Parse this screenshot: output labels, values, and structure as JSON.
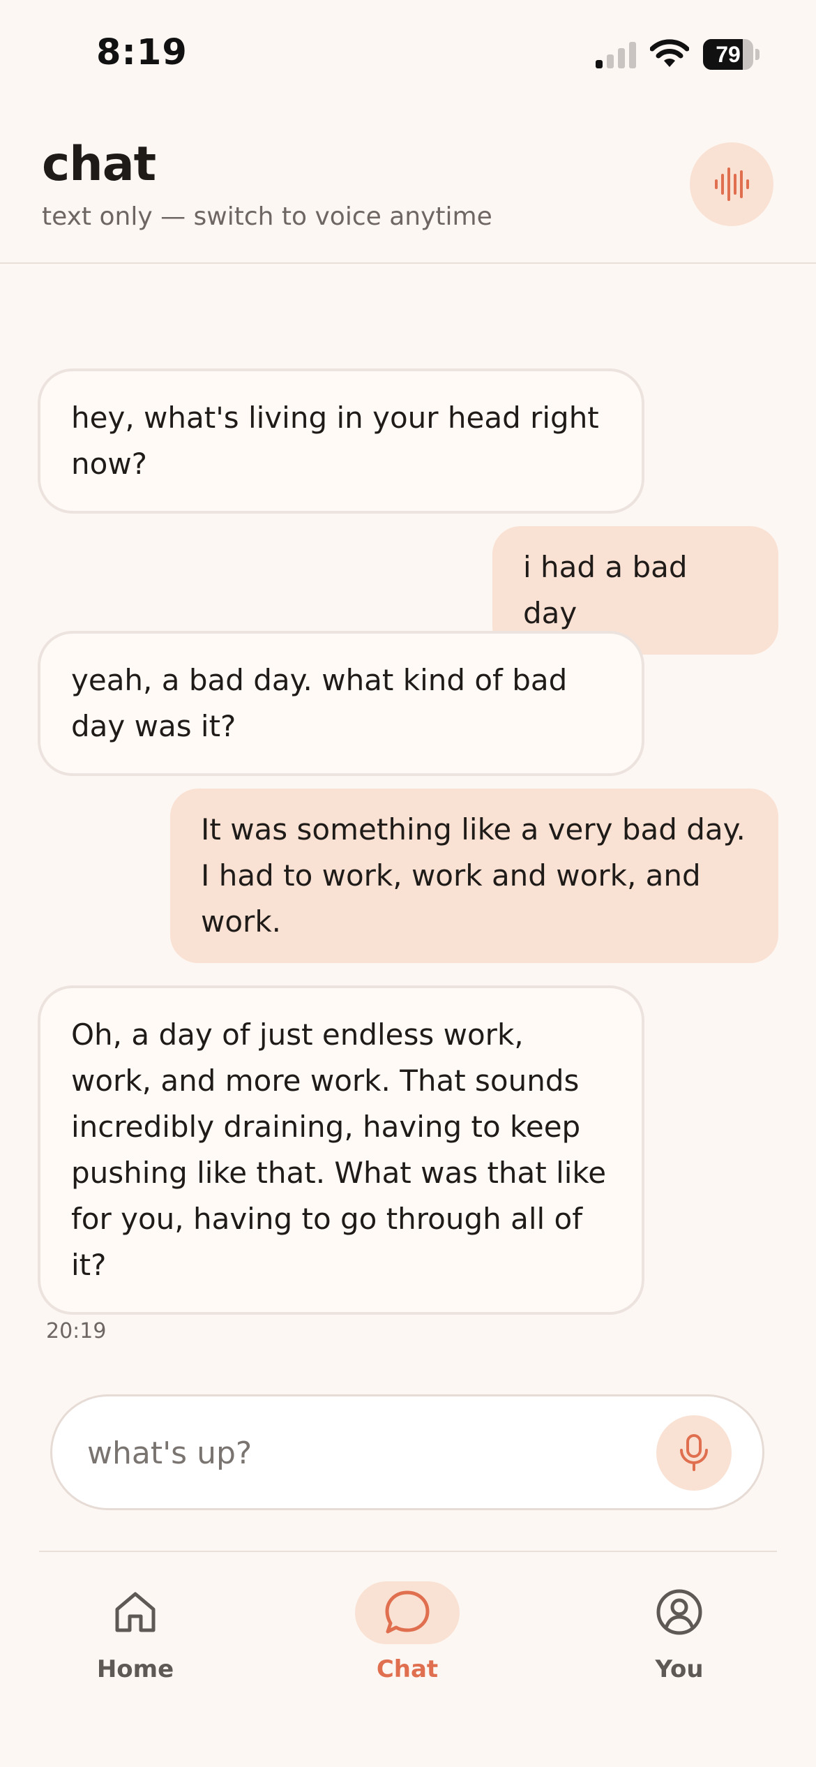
{
  "status_bar": {
    "time": "8:19",
    "battery": "79",
    "battery_level": 0.79,
    "signal_bars_active": 1,
    "signal_bars_total": 4
  },
  "header": {
    "title": "chat",
    "subtitle": "text only — switch to voice anytime",
    "voice_icon": "voice-waveform-icon"
  },
  "messages": [
    {
      "sender": "bot",
      "text": "hey, what's living in your head right now?"
    },
    {
      "sender": "user",
      "text": "i had a bad day"
    },
    {
      "sender": "bot",
      "text": "yeah, a bad day. what kind of bad day was it?"
    },
    {
      "sender": "user",
      "text": "It was something like a very bad day. I had to work, work and work, and work."
    },
    {
      "sender": "bot",
      "text": "Oh, a day of just endless work, work, and more work. That sounds incredibly draining, having to keep pushing like that. What was that like for you, having to go through all of it?"
    }
  ],
  "last_timestamp": "20:19",
  "composer": {
    "placeholder": "what's up?",
    "value": "",
    "mic_icon": "microphone-icon"
  },
  "tabs": [
    {
      "label": "Home",
      "icon": "home-icon",
      "active": false
    },
    {
      "label": "Chat",
      "icon": "chat-bubble-icon",
      "active": true
    },
    {
      "label": "You",
      "icon": "user-circle-icon",
      "active": false
    }
  ],
  "colors": {
    "background": "#fdf7f3",
    "accent": "#e06f4f",
    "accent_soft": "#f9e2d4",
    "bot_bubble": "#fffaf6",
    "bot_border": "#ede3de",
    "text_primary": "#1f1b19",
    "text_secondary": "#6d6662"
  }
}
